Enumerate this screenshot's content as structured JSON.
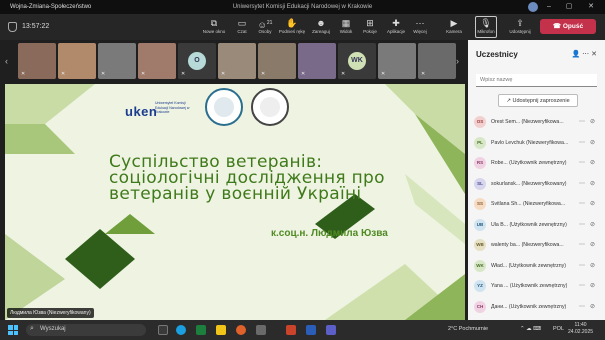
{
  "window": {
    "title": "Wojna-Zmiana-Społeczeństwo",
    "org": "Uniwersytet Komisji Edukacji Narodowej w Krakowie"
  },
  "toolbar": {
    "timer": "13:57:22",
    "items": [
      {
        "label": "Nowe okno",
        "icon": "new-window-icon"
      },
      {
        "label": "Czat",
        "icon": "chat-icon"
      },
      {
        "label": "Osoby",
        "icon": "people-icon",
        "badge": "21"
      },
      {
        "label": "Podnieś rękę",
        "icon": "raise-hand-icon"
      },
      {
        "label": "Zareaguj",
        "icon": "react-icon"
      },
      {
        "label": "Widok",
        "icon": "view-icon"
      },
      {
        "label": "Pokoje",
        "icon": "rooms-icon"
      },
      {
        "label": "Aplikacje",
        "icon": "apps-icon"
      },
      {
        "label": "Więcej",
        "icon": "more-icon"
      },
      {
        "label": "Kamera",
        "icon": "camera-off-icon"
      },
      {
        "label": "Mikrofon",
        "icon": "mic-off-icon"
      },
      {
        "label": "Udostępnij",
        "icon": "share-icon"
      }
    ],
    "leave": "Opuść"
  },
  "thumbnails": [
    {
      "initials": "",
      "color": "#8a6a5a"
    },
    {
      "initials": "",
      "color": "#b08a6a"
    },
    {
      "initials": "",
      "color": "#7a7a7a"
    },
    {
      "initials": "",
      "color": "#a07a6a"
    },
    {
      "initials": "O",
      "color": "#b7d9d8"
    },
    {
      "initials": "",
      "color": "#9a8a7a"
    },
    {
      "initials": "",
      "color": "#8a7a6a"
    },
    {
      "initials": "",
      "color": "#7a6a8a"
    },
    {
      "initials": "WK",
      "color": "#cfe0b4"
    },
    {
      "initials": "",
      "color": "#7a7a7a"
    },
    {
      "initials": "",
      "color": "#6a6a6a"
    }
  ],
  "slide": {
    "logo": "uken",
    "logo_sub": "Uniwersytet Komisji Edukacji Narodowej w Krakowie",
    "title": "Суспільство ветеранів: соціологічні дослідження про ветеранів у воєнній Україні",
    "author": "к.соц.н. Людмила Юзва",
    "speaker_tag": "Людмила Юзва (Niezweryfikowany)"
  },
  "panel": {
    "title": "Uczestnicy",
    "search_placeholder": "Wpisz nazwę",
    "share_button": "Udostępnij zaproszenie",
    "participants": [
      {
        "initials": "OS",
        "name": "Orest Sem... (Niezweryfikowa...",
        "bg": "#f3d0d0",
        "fg": "#9a3a3a"
      },
      {
        "initials": "PL",
        "name": "Pavlo Levchuk (Niezweryfikowa...",
        "bg": "#d7e8c6",
        "fg": "#4a6b2a"
      },
      {
        "initials": "RS",
        "name": "Robe... (Użytkownik zewnętrzny)",
        "bg": "#f0d2e2",
        "fg": "#8a3a6a"
      },
      {
        "initials": "SL",
        "name": "sokurlansk... (Niezweryfikowany)",
        "bg": "#d8d5ee",
        "fg": "#4a4a8a"
      },
      {
        "initials": "SS",
        "name": "Svitlana Sh... (Niezweryfikowa...",
        "bg": "#f6dcc4",
        "fg": "#8a5a2a"
      },
      {
        "initials": "UB",
        "name": "Ula B... (Użytkownik zewnętrzny)",
        "bg": "#cfe4f0",
        "fg": "#2a5a7a"
      },
      {
        "initials": "WB",
        "name": "walenty ba... (Niezweryfikowa...",
        "bg": "#e6e0c4",
        "fg": "#6a5a2a"
      },
      {
        "initials": "WK",
        "name": "Wład... (Użytkownik zewnętrzny)",
        "bg": "#d7e8c6",
        "fg": "#4a6b2a"
      },
      {
        "initials": "YZ",
        "name": "Yana ... (Użytkownik zewnętrzny)",
        "bg": "#cfe4f0",
        "fg": "#2a5a7a"
      },
      {
        "initials": "CH",
        "name": "Дани... (Użytkownik zewnętrzny)",
        "bg": "#f0d2e2",
        "fg": "#8a3a6a"
      }
    ]
  },
  "taskbar": {
    "search": "Wyszukaj",
    "weather": "2°C  Pochmurnie",
    "lang": "POL",
    "time": "11:40",
    "date": "24.02.2025"
  }
}
